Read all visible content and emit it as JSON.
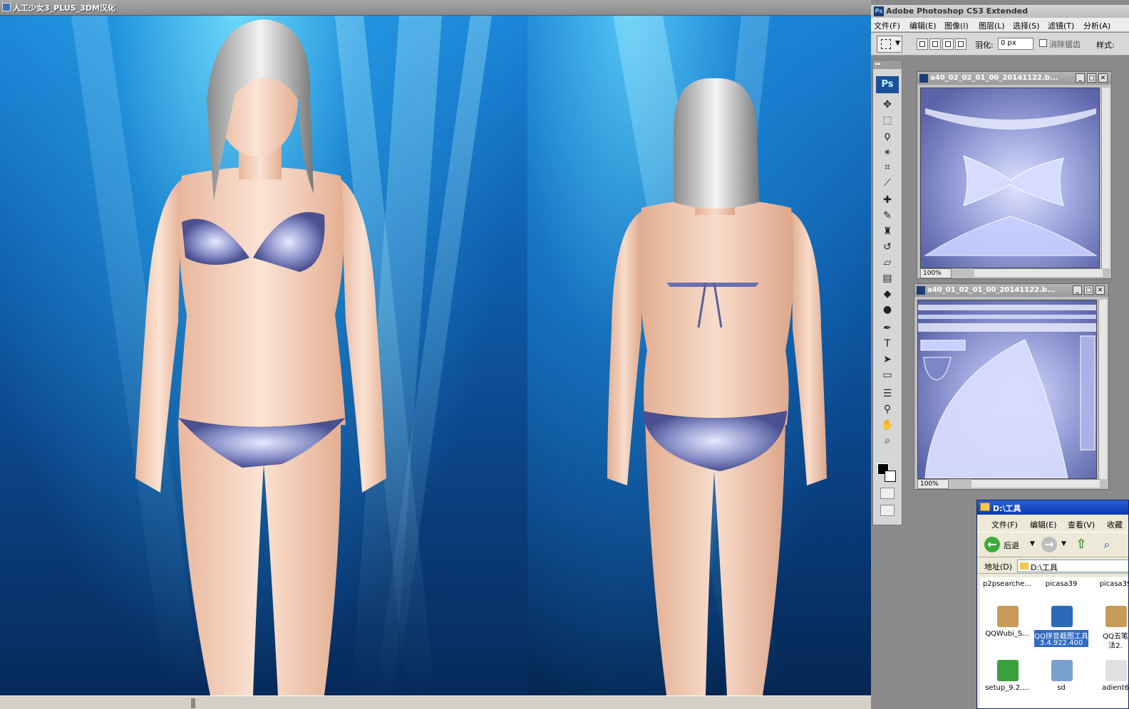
{
  "game": {
    "title": "人工少女3_PLUS_3DM汉化"
  },
  "photoshop": {
    "title": "Adobe Photoshop CS3 Extended",
    "logo": "Ps",
    "menus": [
      "文件(F)",
      "编辑(E)",
      "图像(I)",
      "图层(L)",
      "选择(S)",
      "滤镜(T)",
      "分析(A)"
    ],
    "options": {
      "feather_label": "羽化:",
      "feather_value": "0 px",
      "antialias_label": "消除锯齿",
      "style_label": "样式:"
    },
    "tools": [
      {
        "name": "move-tool-icon",
        "glyph": "✥"
      },
      {
        "name": "marquee-tool-icon",
        "glyph": "⬚"
      },
      {
        "name": "lasso-tool-icon",
        "glyph": "ϙ"
      },
      {
        "name": "magic-wand-tool-icon",
        "glyph": "⚹"
      },
      {
        "name": "crop-tool-icon",
        "glyph": "⌗"
      },
      {
        "name": "slice-tool-icon",
        "glyph": "⟋"
      },
      {
        "name": "healing-brush-tool-icon",
        "glyph": "✚"
      },
      {
        "name": "brush-tool-icon",
        "glyph": "✎"
      },
      {
        "name": "clone-stamp-tool-icon",
        "glyph": "♜"
      },
      {
        "name": "history-brush-tool-icon",
        "glyph": "↺"
      },
      {
        "name": "eraser-tool-icon",
        "glyph": "▱"
      },
      {
        "name": "gradient-tool-icon",
        "glyph": "▤"
      },
      {
        "name": "blur-tool-icon",
        "glyph": "◆"
      },
      {
        "name": "dodge-tool-icon",
        "glyph": "●"
      },
      {
        "name": "pen-tool-icon",
        "glyph": "✒"
      },
      {
        "name": "type-tool-icon",
        "glyph": "T"
      },
      {
        "name": "path-selection-tool-icon",
        "glyph": "➤"
      },
      {
        "name": "shape-tool-icon",
        "glyph": "▭"
      },
      {
        "name": "notes-tool-icon",
        "glyph": "☰"
      },
      {
        "name": "eyedropper-tool-icon",
        "glyph": "⚲"
      },
      {
        "name": "hand-tool-icon",
        "glyph": "✋"
      },
      {
        "name": "zoom-tool-icon",
        "glyph": "⌕"
      }
    ],
    "documents": [
      {
        "title": "a40_02_02_01_00_20141122.b...",
        "zoom": "100%"
      },
      {
        "title": "a40_01_02_01_00_20141122.b...",
        "zoom": "100%"
      }
    ]
  },
  "explorer": {
    "title": "D:\\工具",
    "menus": [
      "文件(F)",
      "编辑(E)",
      "查看(V)",
      "收藏"
    ],
    "back_label": "后退",
    "address_label": "地址(D)",
    "address_value": "D:\\工具",
    "files": [
      {
        "name": "p2psearche...",
        "icon": "none"
      },
      {
        "name": "picasa39",
        "icon": "none"
      },
      {
        "name": "picasa39",
        "icon": "none"
      },
      {
        "name": "QQWubi_S...",
        "icon": "installer-box-icon",
        "color": "#c89a5a"
      },
      {
        "name": "QQ拼音截图工具",
        "sub": "3.4.922.400",
        "icon": "monitor-icon",
        "color": "#2a6ab8",
        "selected": true
      },
      {
        "name": "QQ五笔",
        "sub": "法2.",
        "icon": "installer-box-icon",
        "color": "#c89a5a"
      },
      {
        "name": "setup_9.2....",
        "icon": "setup-icon",
        "color": "#3aa03a"
      },
      {
        "name": "sd",
        "icon": "character-icon",
        "color": "#7aa0d0"
      },
      {
        "name": "adient6",
        "icon": "document-icon",
        "color": "#e0e0e0"
      }
    ]
  }
}
